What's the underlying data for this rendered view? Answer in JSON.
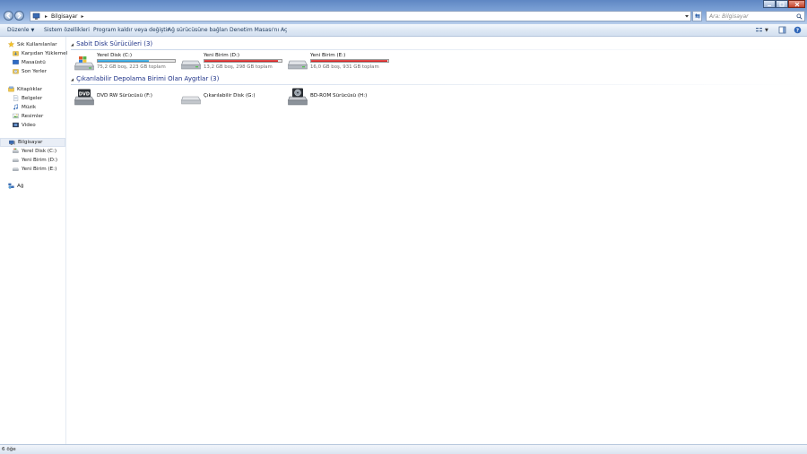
{
  "address": {
    "path": "Bilgisayar",
    "search_placeholder": "Ara: Bilgisayar"
  },
  "toolbar": {
    "organize": "Düzenle",
    "system_properties": "Sistem özellikleri",
    "uninstall": "Program kaldır veya değiştir",
    "map_drive": "Ağ sürücüsüne bağlan",
    "control_panel": "Denetim Masası'nı Aç"
  },
  "sidebar": {
    "favorites": {
      "label": "Sık Kullanılanlar",
      "items": [
        "Karşıdan Yüklemeler",
        "Masaüstü",
        "Son Yerler"
      ]
    },
    "libraries": {
      "label": "Kitaplıklar",
      "items": [
        "Belgeler",
        "Müzik",
        "Resimler",
        "Video"
      ]
    },
    "computer": {
      "label": "Bilgisayar",
      "items": [
        "Yerel Disk (C:)",
        "Yeni Birim (D:)",
        "Yeni Birim (E:)"
      ]
    },
    "network": {
      "label": "Ağ"
    }
  },
  "groups": {
    "hard_disks": {
      "title": "Sabit Disk Sürücüleri (3)",
      "drives": [
        {
          "name": "Yerel Disk (C:)",
          "free": "75,2 GB boş, 223 GB toplam",
          "used_fraction": 0.66,
          "color": "#2a9bd8"
        },
        {
          "name": "Yeni Birim (D:)",
          "free": "13,2 GB boş, 298 GB toplam",
          "used_fraction": 0.955,
          "color": "#d42020"
        },
        {
          "name": "Yeni Birim (E:)",
          "free": "16,0 GB boş, 931 GB toplam",
          "used_fraction": 0.983,
          "color": "#d42020"
        }
      ]
    },
    "removable": {
      "title": "Çıkarılabilir Depolama Birimi Olan Aygıtlar (3)",
      "drives": [
        {
          "name": "DVD RW Sürücüsü (F:)",
          "icon": "dvd-drive-icon"
        },
        {
          "name": "Çıkarılabilir Disk (G:)",
          "icon": "removable-disk-icon"
        },
        {
          "name": "BD-ROM Sürücüsü (H:)",
          "icon": "bd-drive-icon"
        }
      ]
    }
  },
  "status": {
    "items": "6 öğe"
  }
}
